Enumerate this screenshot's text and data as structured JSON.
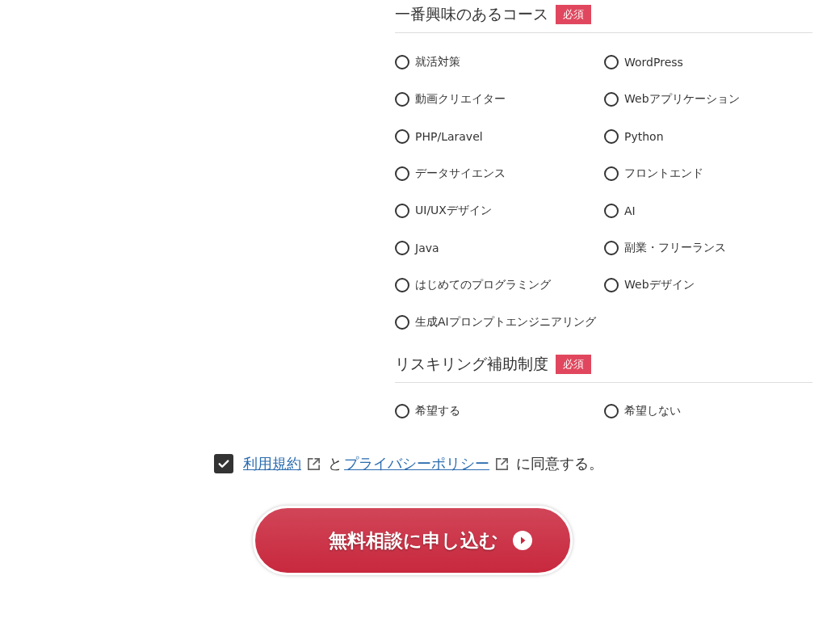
{
  "sections": [
    {
      "title": "一番興味のあるコース",
      "badge": "必須",
      "options": [
        {
          "label": "就活対策",
          "selected": false
        },
        {
          "label": "WordPress",
          "selected": false
        },
        {
          "label": "動画クリエイター",
          "selected": false
        },
        {
          "label": "Webアプリケーション",
          "selected": false
        },
        {
          "label": "PHP/Laravel",
          "selected": false
        },
        {
          "label": "Python",
          "selected": false
        },
        {
          "label": "データサイエンス",
          "selected": false
        },
        {
          "label": "フロントエンド",
          "selected": false
        },
        {
          "label": "UI/UXデザイン",
          "selected": false
        },
        {
          "label": "AI",
          "selected": false
        },
        {
          "label": "Java",
          "selected": false
        },
        {
          "label": "副業・フリーランス",
          "selected": false
        },
        {
          "label": "はじめてのプログラミング",
          "selected": false
        },
        {
          "label": "Webデザイン",
          "selected": false
        },
        {
          "label": "生成AIプロンプトエンジニアリング",
          "selected": false
        }
      ]
    },
    {
      "title": "リスキリング補助制度",
      "badge": "必須",
      "options": [
        {
          "label": "希望する",
          "selected": false
        },
        {
          "label": "希望しない",
          "selected": false
        }
      ]
    }
  ],
  "agreement": {
    "checked": true,
    "parts": [
      {
        "kind": "link",
        "text": "利用規約"
      },
      {
        "kind": "text",
        "text": "と"
      },
      {
        "kind": "link",
        "text": "プライバシーポリシー"
      },
      {
        "kind": "text",
        "text": "に同意する。"
      }
    ]
  },
  "submit": {
    "label": "無料相談に申し込む"
  }
}
